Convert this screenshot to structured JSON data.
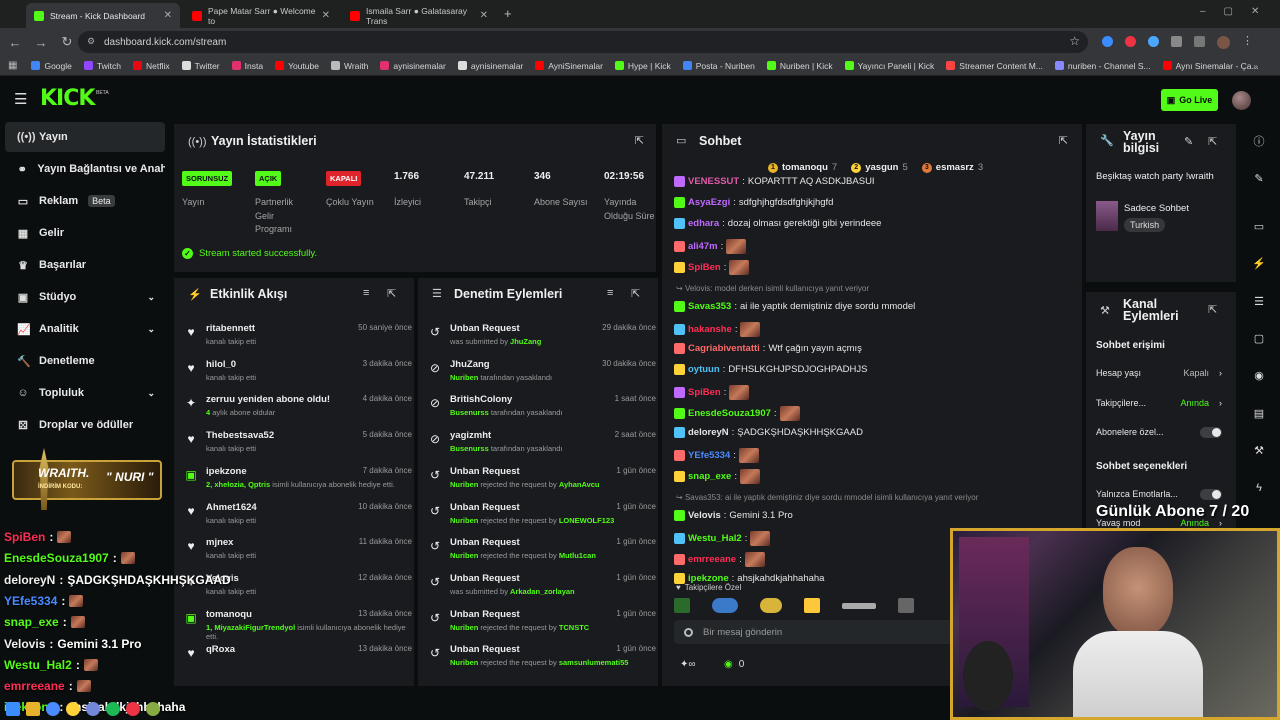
{
  "browser": {
    "tabs": [
      {
        "title": "Stream - Kick Dashboard",
        "color": "#53fc18"
      },
      {
        "title": "Pape Matar Sarr ● Welcome to",
        "color": "#ff0000"
      },
      {
        "title": "Ismaila Sarr ● Galatasaray Trans",
        "color": "#ff0000"
      }
    ],
    "url": "dashboard.kick.com/stream",
    "bookmarks": [
      {
        "label": "Google",
        "color": "#4285f4"
      },
      {
        "label": "Twitch",
        "color": "#9146ff"
      },
      {
        "label": "Netflix",
        "color": "#e50914"
      },
      {
        "label": "Twitter",
        "color": "#dddddd"
      },
      {
        "label": "Insta",
        "color": "#e1306c"
      },
      {
        "label": "Youtube",
        "color": "#ff0000"
      },
      {
        "label": "Wraith",
        "color": "#bbbbbb"
      },
      {
        "label": "aynisinemalar",
        "color": "#e1306c"
      },
      {
        "label": "aynisinemalar",
        "color": "#dddddd"
      },
      {
        "label": "AyniSinemalar",
        "color": "#ff0000"
      },
      {
        "label": "Hype | Kick",
        "color": "#53fc18"
      },
      {
        "label": "Posta - Nuriben",
        "color": "#4285f4"
      },
      {
        "label": "Nuriben | Kick",
        "color": "#53fc18"
      },
      {
        "label": "Yayıncı Paneli | Kick",
        "color": "#53fc18"
      },
      {
        "label": "Streamer Content M...",
        "color": "#ff4444"
      },
      {
        "label": "nuriben - Channel S...",
        "color": "#8888ff"
      },
      {
        "label": "Aynı Sinemalar - Ça...",
        "color": "#ff0000"
      }
    ]
  },
  "header": {
    "logo": "KICK",
    "beta": "BETA",
    "go_live": "Go Live"
  },
  "sidebar": {
    "items": [
      {
        "label": "Yayın",
        "icon": "broadcast-icon",
        "active": true
      },
      {
        "label": "Yayın Bağlantısı ve Anahtarı",
        "icon": "link-icon"
      },
      {
        "label": "Reklam",
        "icon": "ad-icon",
        "badge": "Beta"
      },
      {
        "label": "Gelir",
        "icon": "revenue-icon"
      },
      {
        "label": "Başarılar",
        "icon": "trophy-icon"
      },
      {
        "label": "Stüdyo",
        "icon": "studio-icon",
        "chevron": true
      },
      {
        "label": "Analitik",
        "icon": "analytics-icon",
        "chevron": true
      },
      {
        "label": "Denetleme",
        "icon": "moderation-icon"
      },
      {
        "label": "Topluluk",
        "icon": "community-icon",
        "chevron": true
      },
      {
        "label": "Droplar ve ödüller",
        "icon": "gift-icon"
      }
    ],
    "promo": {
      "brand": "WRAITH.",
      "code_label": "İNDİRİM KODU:",
      "code": "\" NURI \""
    }
  },
  "stats": {
    "title": "Yayın İstatistikleri",
    "items": [
      {
        "tag": "SORUNSUZ",
        "tag_color": "#53fc18",
        "label": "Yayın"
      },
      {
        "tag": "AÇIK",
        "tag_color": "#53fc18",
        "label": "Partnerlik Gelir Programı"
      },
      {
        "tag": "KAPALI",
        "tag_color": "#e0242c",
        "label": "Çoklu Yayın"
      },
      {
        "value": "1.766",
        "label": "İzleyici"
      },
      {
        "value": "47.211",
        "label": "Takipçi"
      },
      {
        "value": "346",
        "label": "Abone Sayısı"
      },
      {
        "value": "02:19:56",
        "label": "Yayında Olduğu Süre"
      }
    ],
    "status": "Stream started successfully."
  },
  "activity": {
    "title": "Etkinlik Akışı",
    "events": [
      {
        "icon": "heart-icon",
        "name": "ritabennett",
        "sub": "kanalı takip etti",
        "time": "50 saniye önce"
      },
      {
        "icon": "heart-icon",
        "name": "hilol_0",
        "sub": "kanalı takip etti",
        "time": "3 dakika önce"
      },
      {
        "icon": "sparkle-icon",
        "name": "zerruu yeniden abone oldu!",
        "sub_green": "4",
        "sub": " aylık abone oldular",
        "time": "4 dakika önce"
      },
      {
        "icon": "heart-icon",
        "name": "Thebestsava52",
        "sub": "kanalı takip etti",
        "time": "5 dakika önce"
      },
      {
        "icon": "gift-icon",
        "name": "ipekzone",
        "sub_green": "2, xhelozia, Qptris",
        "sub": " isimli kullanıcıya abonelik hediye etti.",
        "time": "7 dakika önce"
      },
      {
        "icon": "heart-icon",
        "name": "Ahmet1624",
        "sub": "kanalı takip etti",
        "time": "10 dakika önce"
      },
      {
        "icon": "heart-icon",
        "name": "mjnex",
        "sub": "kanalı takip etti",
        "time": "11 dakika önce"
      },
      {
        "icon": "heart-icon",
        "name": "Velovis",
        "sub": "kanalı takip etti",
        "time": "12 dakika önce"
      },
      {
        "icon": "gift-icon",
        "name": "tomanoqu",
        "sub_green": "1, MiyazakiFigurTrendyol",
        "sub": " isimli kullanıcıya abonelik hediye etti.",
        "time": "13 dakika önce"
      },
      {
        "icon": "heart-icon",
        "name": "qRoxa",
        "sub": "",
        "time": "13 dakika önce"
      }
    ]
  },
  "moderation": {
    "title": "Denetim Eylemleri",
    "actions": [
      {
        "icon": "undo-icon",
        "name": "Unban Request",
        "pre": "was submitted by ",
        "user": "JhuZang",
        "post": "",
        "time": "29 dakika önce"
      },
      {
        "icon": "ban-icon",
        "name": "JhuZang",
        "pre": "",
        "user": "Nuriben",
        "post": " tarafından yasaklandı",
        "time": "30 dakika önce"
      },
      {
        "icon": "ban-icon",
        "name": "BritishColony",
        "pre": "",
        "user": "Busenurss",
        "post": " tarafından yasaklandı",
        "time": "1 saat önce"
      },
      {
        "icon": "ban-icon",
        "name": "yagizmht",
        "pre": "",
        "user": "Busenurss",
        "post": " tarafından yasaklandı",
        "time": "2 saat önce"
      },
      {
        "icon": "undo-icon",
        "name": "Unban Request",
        "pre": "",
        "user": "Nuriben",
        "post": " rejected the request by ",
        "user2": "AyhanAvcu",
        "time": "1 gün önce"
      },
      {
        "icon": "undo-icon",
        "name": "Unban Request",
        "pre": "",
        "user": "Nuriben",
        "post": " rejected the request by ",
        "user2": "LONEWOLF123",
        "time": "1 gün önce"
      },
      {
        "icon": "undo-icon",
        "name": "Unban Request",
        "pre": "",
        "user": "Nuriben",
        "post": " rejected the request by ",
        "user2": "Mutlu1can",
        "time": "1 gün önce"
      },
      {
        "icon": "undo-icon",
        "name": "Unban Request",
        "pre": "was submitted by ",
        "user": "Arkadan_zorlayan",
        "post": "",
        "time": "1 gün önce"
      },
      {
        "icon": "undo-icon",
        "name": "Unban Request",
        "pre": "",
        "user": "Nuriben",
        "post": " rejected the request by ",
        "user2": "TCNSTC",
        "time": "1 gün önce"
      },
      {
        "icon": "undo-icon",
        "name": "Unban Request",
        "pre": "",
        "user": "Nuriben",
        "post": " rejected the request by ",
        "user2": "samsunlumemati55",
        "time": "1 gün önce"
      }
    ]
  },
  "chat": {
    "title": "Sohbet",
    "top": [
      {
        "name": "tomanoqu",
        "count": "7"
      },
      {
        "name": "yasgun",
        "count": "5"
      },
      {
        "name": "esmasrz",
        "count": "3"
      }
    ],
    "lines": [
      {
        "user": "VENESSUT",
        "color": "#e05aa8",
        "text": "KOPARTTT AQ ASDKJBASUI"
      },
      {
        "user": "AsyaEzgi",
        "color": "#c069ff",
        "text": "sdfghjhgfdsdfghjkjhgfd"
      },
      {
        "user": "edhara",
        "color": "#c069ff",
        "text": "dozaj olması gerektiği gibi yerindeee"
      },
      {
        "user": "ali47m",
        "color": "#c069ff",
        "text": "",
        "emote": true
      },
      {
        "user": "SpiBen",
        "color": "#ff2d55",
        "text": "",
        "emote": true
      },
      {
        "sys": "Velovis: model derken isimli kullanıcıya yanıt veriyor"
      },
      {
        "user": "Savas353",
        "color": "#53fc18",
        "text": "ai ile yaptık demiştiniz diye sordu mmodel"
      },
      {
        "user": "hakanshe",
        "color": "#ff2d55",
        "text": "",
        "emote": true
      },
      {
        "user": "Cagriabiventatti",
        "color": "#ff6a6a",
        "text": "Wtf çağın yayın açmış"
      },
      {
        "user": "oytuun",
        "color": "#4fc3f7",
        "text": "DFHSLKGHJPSDJOGHPADHJS"
      },
      {
        "user": "SpiBen",
        "color": "#ff2d55",
        "text": "",
        "emote": true
      },
      {
        "user": "EnesdeSouza1907",
        "color": "#53fc18",
        "text": "",
        "emote": true
      },
      {
        "user": "deloreyN",
        "color": "#e6e6e6",
        "text": "ŞADGKŞHDAŞKHHŞKGAAD"
      },
      {
        "user": "YEfe5334",
        "color": "#4a8bff",
        "text": "",
        "emote": true
      },
      {
        "user": "snap_exe",
        "color": "#53fc18",
        "text": "",
        "emote": true
      },
      {
        "sys": "Savas353: ai ile yaptık demiştiniz diye sordu mmodel isimli kullanıcıya yanıt veriyor"
      },
      {
        "user": "Velovis",
        "color": "#e6e6e6",
        "text": "Gemini 3.1 Pro"
      },
      {
        "user": "Westu_Hal2",
        "color": "#53fc18",
        "text": "",
        "emote": true
      },
      {
        "user": "emrreeane",
        "color": "#ff2d55",
        "text": "",
        "emote": true
      },
      {
        "user": "ipekzone",
        "color": "#53fc18",
        "text": "ahsjkahdkjahhahaha"
      }
    ],
    "follower_label": "Takipçilere Özel",
    "placeholder": "Bir mesaj gönderin",
    "points": "0"
  },
  "info": {
    "title": "Yayın bilgisi",
    "stream_title": "Beşiktaş watch party !wraith",
    "category": "Sadece Sohbet",
    "tag": "Turkish"
  },
  "channel": {
    "title": "Kanal Eylemleri",
    "section1": "Sohbet erişimi",
    "rows": [
      {
        "label": "Hesap yaşı",
        "value": "Kapalı",
        "control": "chevron"
      },
      {
        "label": "Takipçilere...",
        "value": "Anında",
        "control": "chevron"
      },
      {
        "label": "Abonelere özel...",
        "value": "",
        "control": "toggle"
      }
    ],
    "section2": "Sohbet seçenekleri",
    "rows2": [
      {
        "label": "Yalnızca Emotlarla...",
        "value": "",
        "control": "toggle"
      },
      {
        "label": "Yavaş mod",
        "value": "Anında",
        "control": "chevron"
      }
    ]
  },
  "overlay": {
    "sub_goal": "Günlük Abone 7 / 20",
    "chat": [
      {
        "user": "SpiBen",
        "color": "#ff2d55",
        "text": ""
      },
      {
        "user": "EnesdeSouza1907",
        "color": "#53fc18",
        "text": ""
      },
      {
        "user": "deloreyN",
        "color": "#f0f0f0",
        "text": "ŞADGKŞHDAŞKHHŞKGAAD"
      },
      {
        "user": "YEfe5334",
        "color": "#4a8bff",
        "text": ""
      },
      {
        "user": "snap_exe",
        "color": "#53fc18",
        "text": ""
      },
      {
        "user": "Velovis",
        "color": "#f0f0f0",
        "text": "Gemini 3.1 Pro"
      },
      {
        "user": "Westu_Hal2",
        "color": "#53fc18",
        "text": ""
      },
      {
        "user": "emrreeane",
        "color": "#ff2d55",
        "text": ""
      },
      {
        "user": "ipekzone",
        "color": "#53fc18",
        "text": "ahsjkahdkjahhahaha"
      }
    ]
  }
}
